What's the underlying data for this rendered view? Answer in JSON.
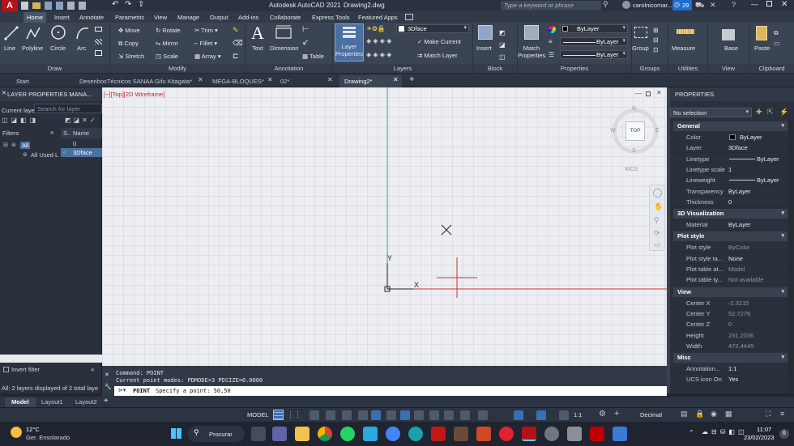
{
  "title_bar": {
    "app_title": "Autodesk AutoCAD 2021",
    "file_title": "Drawing2.dwg",
    "search_placeholder": "Type a keyword or phrase",
    "user": "carolnicomar...",
    "notifications": "29"
  },
  "ribbon_tabs": [
    "Home",
    "Insert",
    "Annotate",
    "Parametric",
    "View",
    "Manage",
    "Output",
    "Add-ins",
    "Collaborate",
    "Express Tools",
    "Featured Apps"
  ],
  "ribbon": {
    "draw": {
      "label": "Draw",
      "line": "Line",
      "polyline": "Polyline",
      "circle": "Circle",
      "arc": "Arc"
    },
    "modify": {
      "label": "Modify",
      "move": "Move",
      "rotate": "Rotate",
      "trim": "Trim",
      "copy": "Copy",
      "mirror": "Mirror",
      "fillet": "Fillet",
      "stretch": "Stretch",
      "scale": "Scale",
      "array": "Array"
    },
    "annotation": {
      "label": "Annotation",
      "text": "Text",
      "dimension": "Dimension",
      "table": "Table"
    },
    "layers": {
      "label": "Layers",
      "layer_properties": "Layer Properties",
      "current_layer": "3Dface",
      "make_current": "Make Current",
      "match_layer": "Match Layer"
    },
    "block": {
      "label": "Block",
      "insert": "Insert"
    },
    "properties": {
      "label": "Properties",
      "match_properties": "Match Properties",
      "color": "ByLayer",
      "lineweight": "ByLayer",
      "linetype": "ByLayer"
    },
    "groups": {
      "label": "Groups",
      "group": "Group"
    },
    "utilities": {
      "label": "Utilities",
      "measure": "Measure"
    },
    "view": {
      "label": "View",
      "base": "Base"
    },
    "clipboard": {
      "label": "Clipboard",
      "paste": "Paste"
    }
  },
  "doc_tabs": [
    {
      "label": "Start"
    },
    {
      "label": "DesenhosTécnicos SANAA Gifu Kitagata*"
    },
    {
      "label": "MEGA-BLOQUES*"
    },
    {
      "label": "02*"
    },
    {
      "label": "Drawing2*"
    }
  ],
  "layer_palette": {
    "title": "LAYER PROPERTIES MANA...",
    "current_layer_label": "Current laye",
    "search_placeholder": "Search for layer",
    "filters_label": "Filters",
    "col_status": "S..",
    "col_name": "Name",
    "tree_all": "All",
    "tree_used": "All Used L",
    "layers": [
      {
        "name": "0"
      },
      {
        "name": "3Dface"
      }
    ],
    "invert_filter": "Invert filter",
    "status_text": "All: 2 layers displayed of 2 total laye"
  },
  "viewport": {
    "label": "[−][Top][2D Wireframe]",
    "viewcube_top": "TOP",
    "viewcube_n": "N",
    "viewcube_s": "S",
    "viewcube_w": "W",
    "viewcube_e": "E",
    "wcs": "WCS",
    "ucs_x": "X",
    "ucs_y": "Y"
  },
  "command": {
    "line1": "Command: POINT",
    "line2": "Current point modes:  PDMODE=3  PDSIZE=0.0000",
    "prompt_cmd": "POINT",
    "prompt_text": "Specify a point: 50,50"
  },
  "properties_palette": {
    "title": "PROPERTIES",
    "selection": "No selection",
    "sections": [
      {
        "name": "General",
        "rows": [
          {
            "label": "Color",
            "value": "ByLayer"
          },
          {
            "label": "Layer",
            "value": "3Dface"
          },
          {
            "label": "Linetype",
            "value": "ByLayer"
          },
          {
            "label": "Linetype scale",
            "value": "1"
          },
          {
            "label": "Lineweight",
            "value": "ByLayer"
          },
          {
            "label": "Transparency",
            "value": "ByLayer"
          },
          {
            "label": "Thickness",
            "value": "0"
          }
        ]
      },
      {
        "name": "3D Visualization",
        "rows": [
          {
            "label": "Material",
            "value": "ByLayer"
          }
        ]
      },
      {
        "name": "Plot style",
        "rows": [
          {
            "label": "Plot style",
            "value": "ByColor"
          },
          {
            "label": "Plot style ta...",
            "value": "None"
          },
          {
            "label": "Plot table at...",
            "value": "Model"
          },
          {
            "label": "Plot table ty...",
            "value": "Not available"
          }
        ]
      },
      {
        "name": "View",
        "rows": [
          {
            "label": "Center X",
            "value": "-2.3215"
          },
          {
            "label": "Center Y",
            "value": "52.7276"
          },
          {
            "label": "Center Z",
            "value": "0"
          },
          {
            "label": "Height",
            "value": "231.2036"
          },
          {
            "label": "Width",
            "value": "472.4445"
          }
        ]
      },
      {
        "name": "Misc",
        "rows": [
          {
            "label": "Annotation...",
            "value": "1:1"
          },
          {
            "label": "UCS icon On",
            "value": "Yes"
          }
        ]
      }
    ]
  },
  "layout_tabs": [
    "Model",
    "Layout1",
    "Layout2"
  ],
  "status_bar": {
    "model": "MODEL",
    "scale": "1:1",
    "units": "Decimal"
  },
  "taskbar": {
    "weather_temp": "12°C",
    "weather_desc": "Ger. Ensolarado",
    "search": "Procurar",
    "time": "11:07",
    "date": "23/02/2023",
    "badge": "6"
  }
}
